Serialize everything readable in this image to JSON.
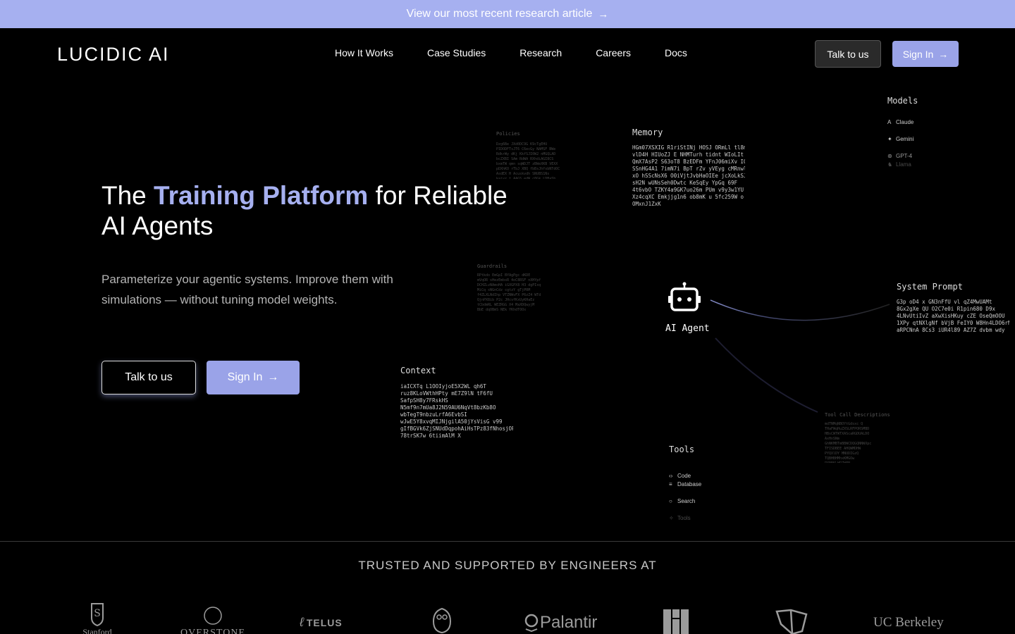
{
  "banner": {
    "text": "View our most recent research article",
    "arrow": "→"
  },
  "nav": {
    "logo": "LUCIDIC AI",
    "links": [
      "How It Works",
      "Case Studies",
      "Research",
      "Careers",
      "Docs"
    ],
    "talk_label": "Talk to us",
    "signin_label": "Sign In"
  },
  "hero": {
    "title_pre": "The ",
    "title_accent": "Training Platform",
    "title_post": " for Reliable AI Agents",
    "subtitle": "Parameterize your agentic systems. Improve them with simulations — without tuning model weights.",
    "talk_label": "Talk to us",
    "signin_label": "Sign In"
  },
  "diagram": {
    "agent_label": "AI Agent",
    "memory": {
      "title": "Memory",
      "text": "HGm07XSXIG R1riStINj HOSJ ORmLl tl8mf\nvlD4H HIUoZJ E NHMTurh tidnt WIoLIt\nQmX7AsP2 S63oT8 BzEDFm YFnJ06miXv IGE\nSSnHG4A1 7imN7i BpT rZv yVEyg cMRnwlG\nxO hSScNsX6 O0iVjtJvbHaOIEe jcXoLkSJG\nsH2N wUNsSeh0Dwtc KeSqEy YpGq 69F\n4t6vbO TZKY4a9GK7uo26m PUm v9y3w1YU\nXz4cqXC Emkjjg1n6 ob8mK u 5fc259W o\nOMxnJ1ZxK"
    },
    "context": {
      "title": "Context",
      "text": "iaICXTq L1OOIyjoE5X2WL qh6T\nruz8KLoVWthHPty mE7Z9lN tF6fU\nSafpSH8y7FRskHS\nN5mf9n7mUa8J2N59AU6NqVt8bzKb8O\nwbTegT9nbzuLrfA6EvbSI\nwJwE5Y8xvqMIJNjgilA50jYsVisG v99\ngIfBGVk6ZjSNUdDqpohAiHsTPz83fNhosjOPM\n78trSK7w 6tiimAlM X"
    },
    "system_prompt": {
      "title": "System Prompt",
      "text": "G3p oD4 x GN3nFfU vl qZ4MwUAMt\n8Gx2gXe QU O2C7e0i R1pin680 D9x\n4LNvUtiIvZ aXwXisHKuy cZE OseQmOOU\n1XPy qtNXlgNf bVjB FeIY0 W8Hn4LDO6rN\naRPCNnA 8Cs3 iUR4l89 AZ7Z dvbm wdy"
    },
    "models": {
      "title": "Models",
      "items": [
        {
          "icon": "claude-icon",
          "label": "Claude"
        },
        {
          "icon": "gemini-icon",
          "label": "Gemini"
        },
        {
          "icon": "gpt-icon",
          "label": "GPT-4"
        },
        {
          "icon": "llama-icon",
          "label": "Llama"
        }
      ]
    },
    "tools": {
      "title": "Tools",
      "items": [
        {
          "icon": "code-icon",
          "label": "Code"
        },
        {
          "icon": "database-icon",
          "label": "Database"
        },
        {
          "icon": "search-icon",
          "label": "Search"
        },
        {
          "icon": "tools-icon",
          "label": "Tools"
        }
      ]
    },
    "policies": {
      "title": "Policies",
      "text": "Dzg6Be JXd0DC9G K9cTgEHU\nPIDODFTsJT6 C6ecGy NAMSF BWe\nRdkrWy dKj KkfSJI0W2 nMGQLAD\nbcZXBI SAm RdWA RXhdiAGI8CS\nbxmTW qmn sqWDJT zBWeXKB VEXX\npDXhKO rTbJ XBQ fbBsJhfsbNTdOC\nAsdEX H Acuskvdh SNUBS1Ns\nkajyz t AAGS edW c0Gk LDBaSb"
    },
    "guardrails": {
      "title": "Guardrails",
      "text": "RPtkdo EmGpI BYAgPgc dKDE\nmVqOR sHezEmbsR 4oC8RSF nXHYpf\nDCHZLvNAmoHA iGXGPX8 H3 dgPIxq\nMiCq sNGnCdz cgtzY gTjPRM\nf4ZLXLNdIhp VTZNWvFX P6zZ4 WTd\nQjnPX8ib P2c JHcvfKxUyKHaEz\ntCbdmRL WEZRGG X4 MaXDQwyjM\nBbE dqOBmS NEk YKhdTOOx"
    },
    "tool_call": {
      "title": "Tool Call Descriptions",
      "text": "mdTNMqNBOYtGdsxc Q\nTHaFWqHuZXSLRFPORSMBD\nHBsCWTWTXAScaRGDUALDO\nAxHnSNm\nGhNKMBTmBBWCDQGQNNWXpc\nTFISDBEE AHQWMDHW\nPYQXlDY MNUDIGzQ\nTQBHBHMhxKMGOw\nPXNBKLHRZHFN\nGGvNMJBr"
    }
  },
  "trusted": {
    "heading": "TRUSTED AND SUPPORTED BY ENGINEERS AT",
    "logos": [
      {
        "name": "stanford",
        "text": "Stanford"
      },
      {
        "name": "overstone",
        "text": "OVERSTONE"
      },
      {
        "name": "telus",
        "text": "TELUS"
      },
      {
        "name": "owl",
        "text": ""
      },
      {
        "name": "palantir",
        "text": "Palantir"
      },
      {
        "name": "building",
        "text": ""
      },
      {
        "name": "box",
        "text": ""
      },
      {
        "name": "ucberkeley",
        "text": "UC Berkeley"
      }
    ]
  },
  "colors": {
    "banner": "#a6b0f0",
    "accent": "#a6b0f0",
    "button": "#9aa3e8",
    "background": "#000000"
  }
}
